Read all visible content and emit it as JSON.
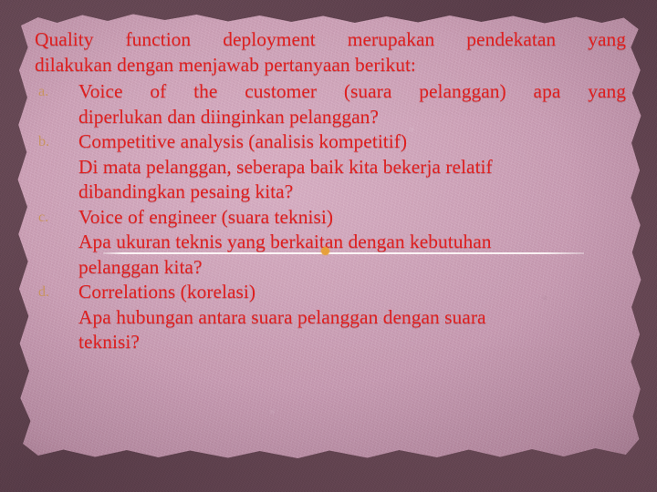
{
  "slide": {
    "intro": {
      "line1": "Quality function deployment merupakan pendekatan yang",
      "line2": "dilakukan dengan menjawab pertanyaan berikut:"
    },
    "items": [
      {
        "marker": "a.",
        "main_line1": "Voice of the customer (suara pelanggan) apa yang",
        "main_line2": "diperlukan dan diinginkan pelanggan?"
      },
      {
        "marker": "b.",
        "main_line1": "Competitive analysis (analisis kompetitif)",
        "sub_line1": "Di mata pelanggan, seberapa baik kita bekerja relatif",
        "sub_line2": "dibandingkan pesaing kita?"
      },
      {
        "marker": "c.",
        "main_line1": "Voice of engineer (suara teknisi)",
        "sub_line1": "Apa ukuran teknis yang berkaitan dengan kebutuhan",
        "sub_line2": "pelanggan kita?"
      },
      {
        "marker": "d.",
        "main_line1": "Correlations (korelasi)",
        "sub_line1": "Apa hubungan antara suara pelanggan dengan suara",
        "sub_line2": "teknisi?"
      }
    ],
    "colors": {
      "body_text": "#e01f1f",
      "marker_text": "#c99460",
      "paper": "#cfa3b9",
      "frame": "#5d404b",
      "scratch_line": "#fffafa",
      "scratch_dot": "#e7a13c"
    }
  }
}
